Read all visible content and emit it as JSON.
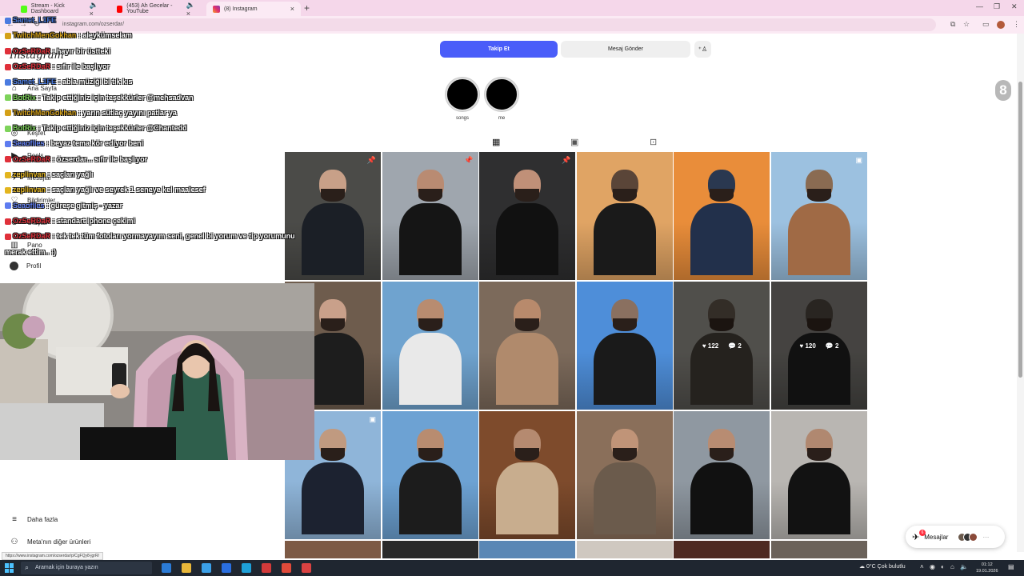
{
  "browser": {
    "tabs": [
      {
        "title": "Stream - Kick Dashboard",
        "active": false
      },
      {
        "title": "(453) Ah Gecelar - YouTube",
        "active": false
      },
      {
        "title": "(8) Instagram",
        "active": true
      }
    ],
    "address": "instagram.com/ozserdar/",
    "status_url": "https://www.instagram.com/ozserdar/p/CgFQy8-jgrR/"
  },
  "instagram": {
    "logo": "Instagram",
    "sidebar": [
      {
        "label": "Ana Sayfa",
        "icon": "home-icon"
      },
      {
        "label": "Ara",
        "icon": "search-icon"
      },
      {
        "label": "Keşfet",
        "icon": "compass-icon"
      },
      {
        "label": "Reels",
        "icon": "reels-icon"
      },
      {
        "label": "Mesajlar",
        "icon": "messenger-icon"
      },
      {
        "label": "Bildirimler",
        "icon": "heart-icon"
      },
      {
        "label": "Oluştur",
        "icon": "plus-icon"
      },
      {
        "label": "Pano",
        "icon": "chart-icon"
      },
      {
        "label": "Profil",
        "icon": "avatar"
      }
    ],
    "sidebar_bottom": [
      {
        "label": "Daha fazla",
        "icon": "menu-icon"
      },
      {
        "label": "Meta'nın diğer ürünleri",
        "icon": "meta-icon"
      }
    ],
    "profile": {
      "follow_label": "Takip Et",
      "message_label": "Mesaj Gönder"
    },
    "highlights": [
      {
        "label": "songs"
      },
      {
        "label": "me"
      }
    ],
    "tabs": [
      "posts-grid",
      "reels",
      "tagged"
    ],
    "posts": [
      {
        "bg": "#4b4b48",
        "skin": "#c8a088",
        "shirt": "#1b1f26",
        "pin": "📌"
      },
      {
        "bg": "#9fa6ae",
        "skin": "#b98b72",
        "shirt": "#151515",
        "pin": "📌"
      },
      {
        "bg": "#2f2f30",
        "skin": "#c09078",
        "shirt": "#111111",
        "pin": "📌"
      },
      {
        "bg": "#e0a464",
        "skin": "#5a4538",
        "shirt": "#1a1a1a",
        "pin": ""
      },
      {
        "bg": "#e98d3a",
        "skin": "#2a3850",
        "shirt": "#22304b",
        "pin": ""
      },
      {
        "bg": "#9cc1e0",
        "skin": "#8a6b52",
        "shirt": "#a06a45",
        "pin": "▣"
      },
      {
        "bg": "#6e5c4d",
        "skin": "#c9a08a",
        "shirt": "#1d1d1d",
        "pin": ""
      },
      {
        "bg": "#6fa3cf",
        "skin": "#b88c70",
        "shirt": "#e9e9e9",
        "pin": ""
      },
      {
        "bg": "#7c6a5b",
        "skin": "#b88a6c",
        "shirt": "#b08a6c",
        "pin": ""
      },
      {
        "bg": "#4e8ed9",
        "skin": "#8a7060",
        "shirt": "#1a1a1a",
        "pin": ""
      },
      {
        "bg": "#7c7a74",
        "skin": "#4f463c",
        "shirt": "#3a352f",
        "pin": "",
        "likes": "122",
        "comments": "2"
      },
      {
        "bg": "#6a6864",
        "skin": "#3f3a34",
        "shirt": "#1b1b1b",
        "pin": "",
        "likes": "120",
        "comments": "2"
      },
      {
        "bg": "#8fb5d9",
        "skin": "#c09a80",
        "shirt": "#1c2230",
        "pin": "▣"
      },
      {
        "bg": "#6da2d3",
        "skin": "#b88c70",
        "shirt": "#1c1c1c",
        "pin": ""
      },
      {
        "bg": "#7e4b2c",
        "skin": "#b58a70",
        "shirt": "#c8ad8e",
        "pin": ""
      },
      {
        "bg": "#8a6f5a",
        "skin": "#c09478",
        "shirt": "#6b5b4c",
        "pin": ""
      },
      {
        "bg": "#8f98a1",
        "skin": "#b88c72",
        "shirt": "#111111",
        "pin": ""
      },
      {
        "bg": "#b9b6b2",
        "skin": "#b08870",
        "shirt": "#121212",
        "pin": ""
      }
    ],
    "last_row": [
      "#7d5a45",
      "#2a2a2a",
      "#5a87b5",
      "#cfc8c0",
      "#4e2a22",
      "#6b625a"
    ],
    "messages_pill": {
      "label": "Mesajlar",
      "count": "6"
    },
    "notification_count": "8"
  },
  "stream_chat": [
    {
      "user": "Samet_L1FE",
      "color": "#4a7be0",
      "text": ""
    },
    {
      "user": "TwitchMenGokhan",
      "color": "#d4a017",
      "text": "aleykümselam"
    },
    {
      "user": "OzSeRDaR",
      "color": "#e0303a",
      "text": "hayır bir üstteki"
    },
    {
      "user": "OzSeRDaR",
      "color": "#e0303a",
      "text": "sıfır ile başlıyor"
    },
    {
      "user": "Samet_L1FE",
      "color": "#4a7be0",
      "text": "abla müziği bi tık kıs"
    },
    {
      "user": "BotRix",
      "color": "#7dd35a",
      "text": "Takip ettiğiniz için teşekkürler @mehsadvan"
    },
    {
      "user": "TwitchMenGokhan",
      "color": "#d4a017",
      "text": "yarın sütlaç yayını patlar ya"
    },
    {
      "user": "BotRix",
      "color": "#7dd35a",
      "text": "Takip ettiğiniz için teşekkürler @Chantedd"
    },
    {
      "user": "Seaoflies",
      "color": "#5d7cf0",
      "text": "beyaz tema kör ediyor beni"
    },
    {
      "user": "OzSeRDaR",
      "color": "#e0303a",
      "text": "özserdar... sıfır ile başlıyor"
    },
    {
      "user": "zeplinvan",
      "color": "#e3b51e",
      "text": "saçları yağlı"
    },
    {
      "user": "zeplinvan",
      "color": "#e3b51e",
      "text": "saçları yağlı ve seyrek 1 seneye kel maalesef"
    },
    {
      "user": "Seaoflies",
      "color": "#5d7cf0",
      "text": "güreşe gitmiş - yazar"
    },
    {
      "user": "OzSeRDaR",
      "color": "#e0303a",
      "text": "standart iphone çekimi"
    },
    {
      "user": "OzSeRDaR",
      "color": "#e0303a",
      "text": "tek tek tüm fotoları yormayayım seni, genel bi yorum ve tip yorumunu"
    },
    {
      "user": "",
      "color": "#ffffff",
      "text": "merak ettim.. :)"
    }
  ],
  "taskbar": {
    "search_placeholder": "Aramak için buraya yazın",
    "weather": "0°C  Çok bulutlu",
    "time": "01:12",
    "date": "19.01.2026",
    "apps": [
      "#2b7bd6",
      "#e8b73a",
      "#3ba0e8",
      "#2a6fe0",
      "#1ea0d8",
      "#d23a3a",
      "#e04a3a",
      "#d94242"
    ]
  }
}
